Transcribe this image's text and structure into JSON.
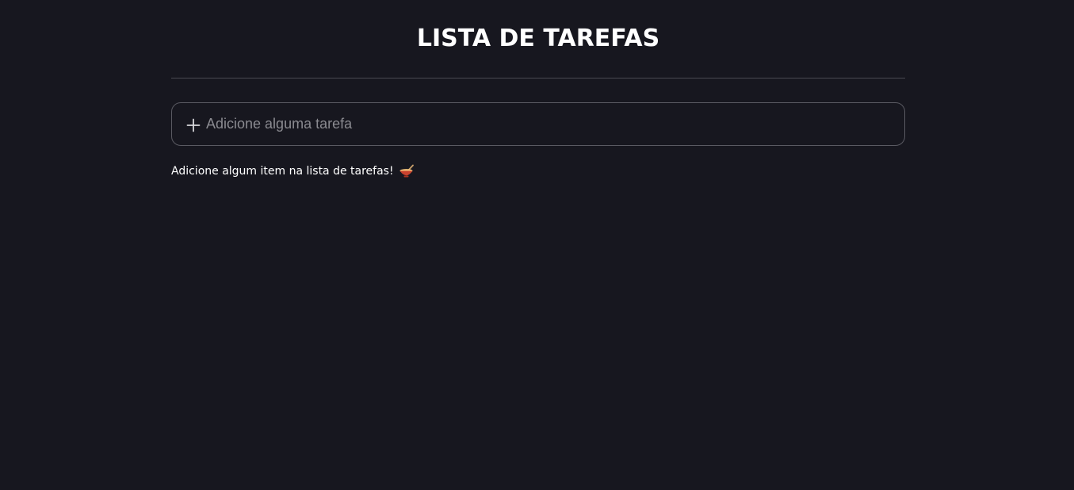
{
  "header": {
    "title": "LISTA DE TAREFAS"
  },
  "add_task": {
    "placeholder": "Adicione alguma tarefa",
    "value": "",
    "icon": "plus-icon"
  },
  "empty_state": {
    "message": "Adicione algum item na lista de tarefas!",
    "icon": "bowl-icon"
  },
  "colors": {
    "background": "#17171f",
    "text": "#ffffff",
    "border": "#5a5a62",
    "divider": "#4a4a52",
    "placeholder": "#8a8a90"
  }
}
